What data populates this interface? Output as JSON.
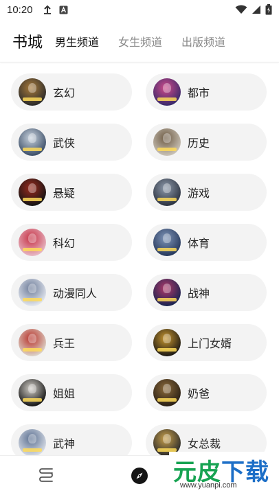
{
  "status_bar": {
    "time": "10:20",
    "left_icons": [
      "download-icon",
      "app-a-icon"
    ],
    "right_icons": [
      "wifi-icon",
      "signal-icon",
      "battery-icon"
    ]
  },
  "header": {
    "title": "书城",
    "tabs": [
      {
        "label": "男生频道",
        "active": true
      },
      {
        "label": "女生频道",
        "active": false
      },
      {
        "label": "出版频道",
        "active": false
      }
    ]
  },
  "categories": [
    {
      "label": "玄幻",
      "cover_colors": [
        "#2b2b2b",
        "#a87a3a"
      ]
    },
    {
      "label": "都市",
      "cover_colors": [
        "#3a2a6a",
        "#d04a8a"
      ]
    },
    {
      "label": "武侠",
      "cover_colors": [
        "#3d4f68",
        "#c9d3de"
      ]
    },
    {
      "label": "历史",
      "cover_colors": [
        "#c9c2b6",
        "#6e5b44"
      ]
    },
    {
      "label": "悬疑",
      "cover_colors": [
        "#141414",
        "#9b2b1e"
      ]
    },
    {
      "label": "游戏",
      "cover_colors": [
        "#2c3340",
        "#8e9aab"
      ]
    },
    {
      "label": "科幻",
      "cover_colors": [
        "#e7b8c4",
        "#c63144"
      ]
    },
    {
      "label": "体育",
      "cover_colors": [
        "#27395c",
        "#7f95b8"
      ]
    },
    {
      "label": "动漫同人",
      "cover_colors": [
        "#e2e6ee",
        "#6c7b98"
      ]
    },
    {
      "label": "战神",
      "cover_colors": [
        "#1a2450",
        "#b13a6a"
      ]
    },
    {
      "label": "兵王",
      "cover_colors": [
        "#dcd3c8",
        "#b8322a"
      ]
    },
    {
      "label": "上门女婿",
      "cover_colors": [
        "#1e1a14",
        "#c8962e"
      ]
    },
    {
      "label": "姐姐",
      "cover_colors": [
        "#161616",
        "#d3cfc8"
      ]
    },
    {
      "label": "奶爸",
      "cover_colors": [
        "#2a2015",
        "#8c6a3a"
      ]
    },
    {
      "label": "武神",
      "cover_colors": [
        "#d8dde6",
        "#5a6f90"
      ]
    },
    {
      "label": "女总裁",
      "cover_colors": [
        "#2b2b2b",
        "#c9a04a"
      ]
    }
  ],
  "bottom_nav": [
    {
      "icon": "bookshelf-icon",
      "active": false
    },
    {
      "icon": "compass-icon",
      "active": true
    }
  ],
  "watermark": {
    "brand_green": "元皮",
    "brand_blue": "下载",
    "url": "www.yuanpi.com",
    "colors": {
      "green": "#17a352",
      "blue": "#1d6fc7"
    }
  }
}
